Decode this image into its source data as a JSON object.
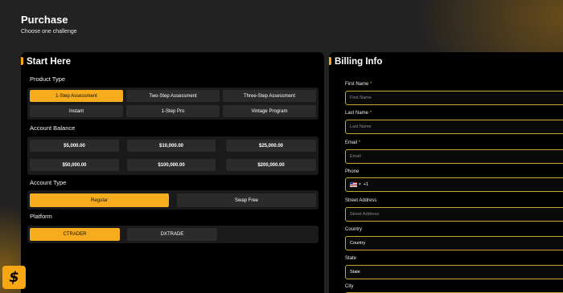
{
  "header": {
    "title": "Purchase",
    "subtitle": "Choose one challenge"
  },
  "left_panel": {
    "heading": "Start Here",
    "product_type": {
      "label": "Product Type",
      "options": [
        "1-Step Assessment",
        "Two-Step Assessment",
        "Three-Step Assessment",
        "Instant",
        "1-Step Pro",
        "Vintage Program"
      ],
      "selected": "1-Step Assessment"
    },
    "account_balance": {
      "label": "Account Balance",
      "options": [
        "$5,000.00",
        "$10,000.00",
        "$25,000.00",
        "$50,000.00",
        "$100,000.00",
        "$200,000.00"
      ]
    },
    "account_type": {
      "label": "Account Type",
      "options": [
        "Regular",
        "Swap Free"
      ],
      "selected": "Regular"
    },
    "platform": {
      "label": "Platform",
      "options": [
        "CTRADER",
        "DXTRADE"
      ],
      "selected": "CTRADER"
    }
  },
  "right_panel": {
    "heading": "Billing Info",
    "required_mark": "*",
    "fields": {
      "first_name": {
        "label": "First Name",
        "placeholder": "First Name"
      },
      "last_name": {
        "label": "Last Name",
        "placeholder": "Last Name"
      },
      "email": {
        "label": "Email",
        "placeholder": "Email"
      },
      "phone": {
        "label": "Phone",
        "value": "+1"
      },
      "street": {
        "label": "Street Address",
        "placeholder": "Street Address"
      },
      "country": {
        "label": "Country",
        "value": "Country"
      },
      "state": {
        "label": "State",
        "value": "State"
      },
      "city": {
        "label": "City"
      }
    }
  },
  "logo": {
    "glyph": "$",
    "icon": "fast-dollar-icon"
  },
  "colors": {
    "accent": "#f6a713",
    "panel": "#000000",
    "option_bg": "#2b2b2b"
  }
}
